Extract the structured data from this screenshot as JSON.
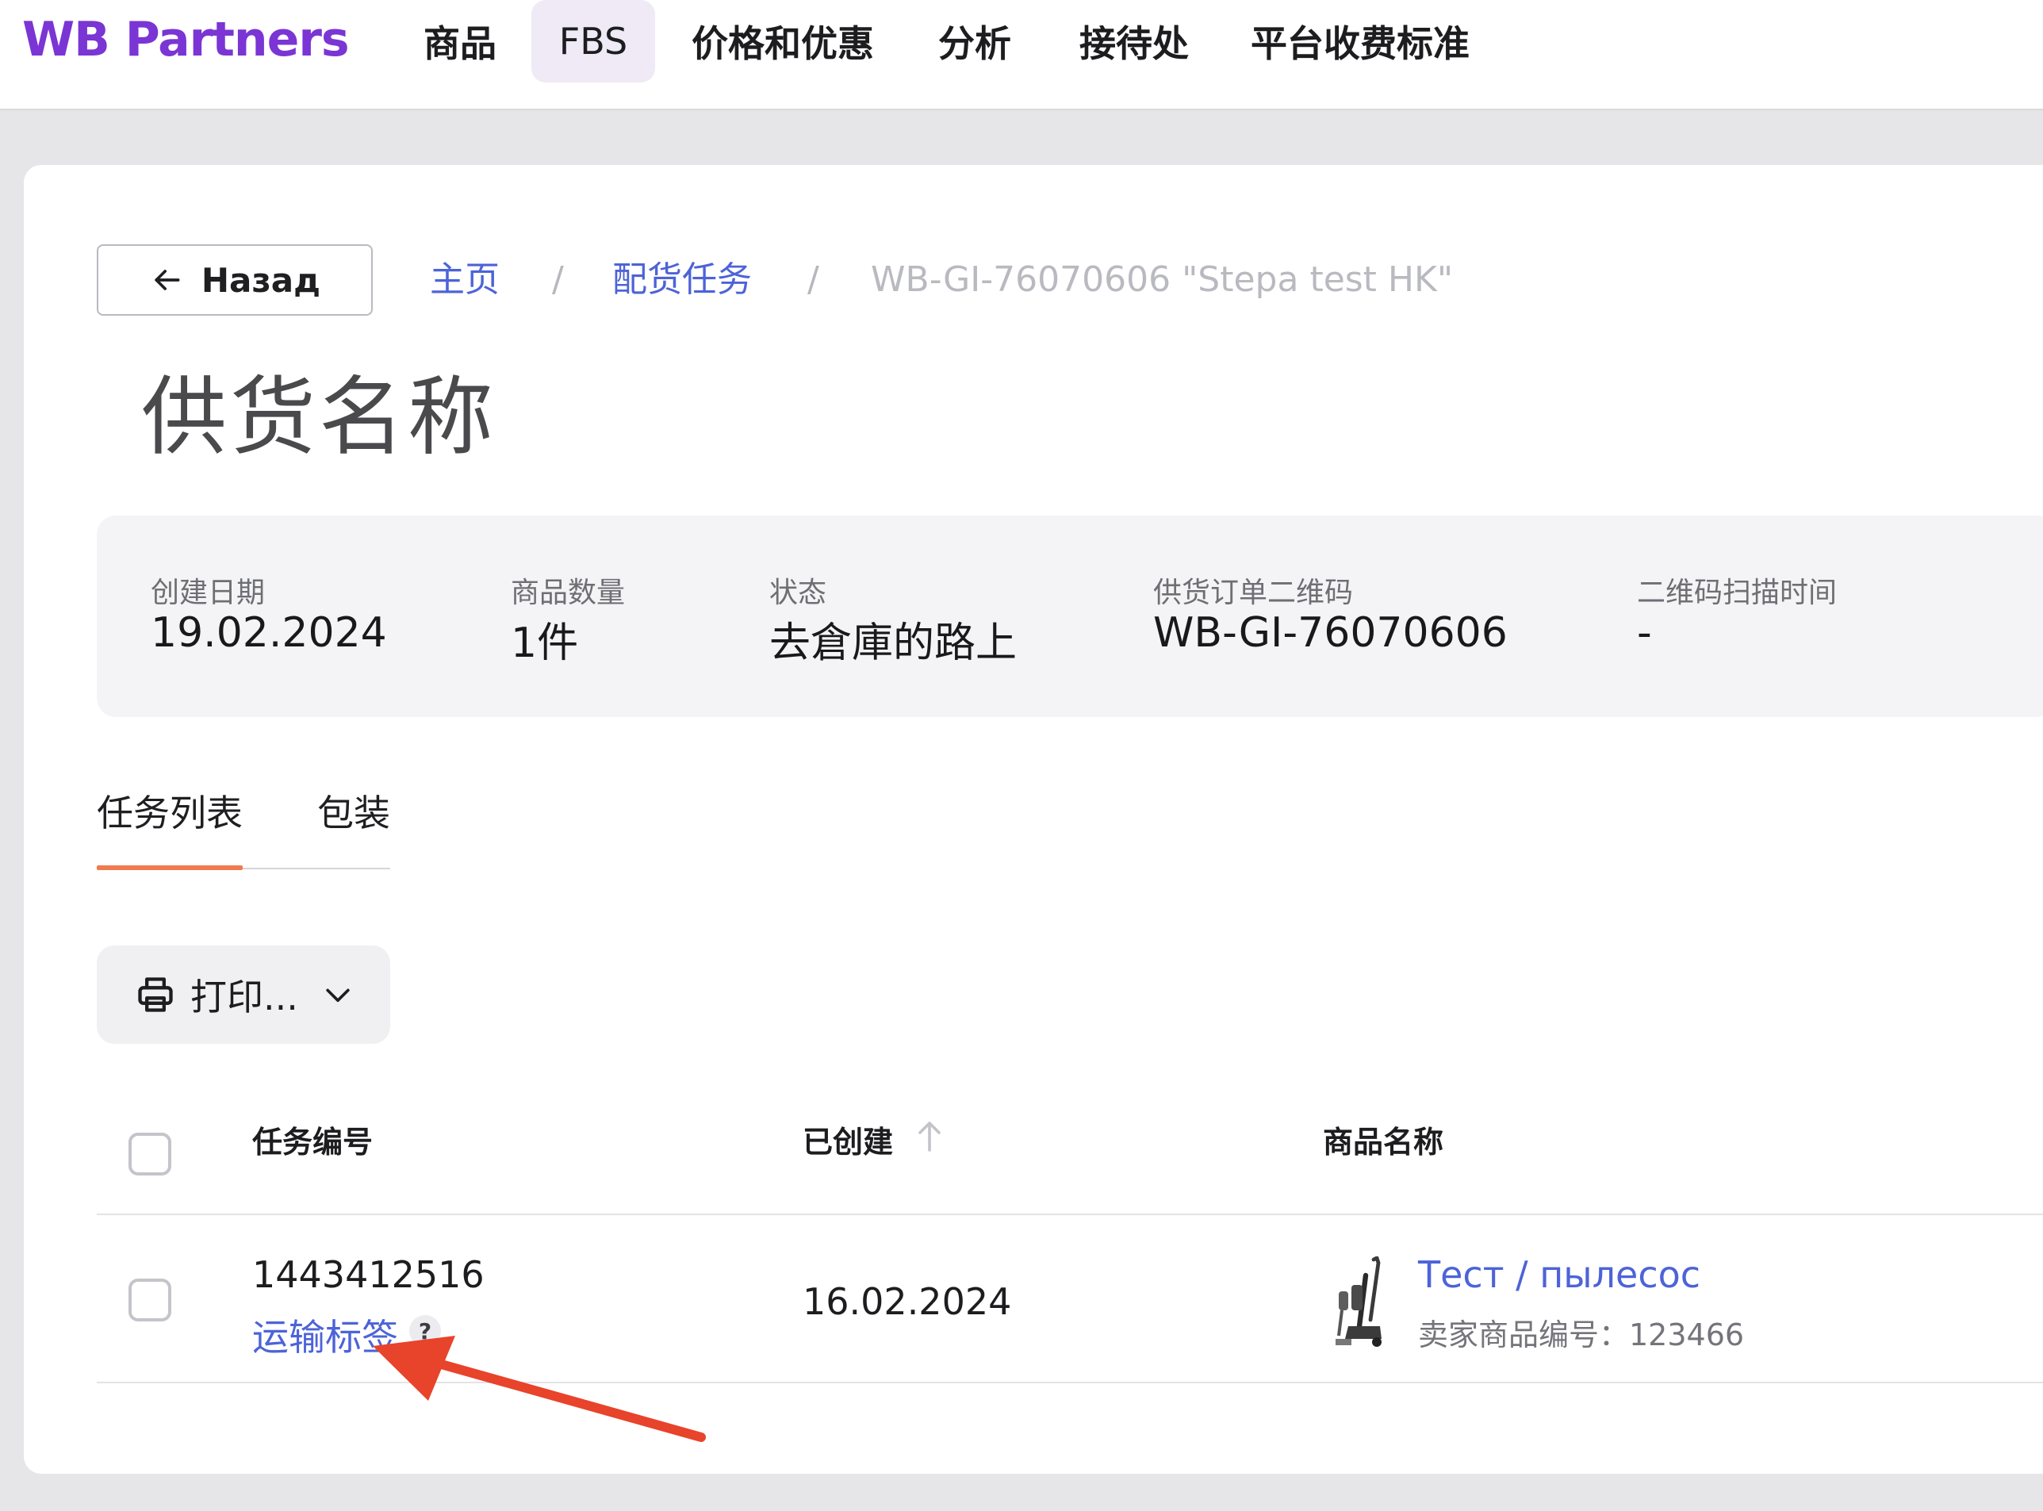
{
  "header": {
    "logo": "WB Partners",
    "nav": [
      "商品",
      "FBS",
      "价格和优惠",
      "分析",
      "接待处",
      "平台收费标准"
    ],
    "active_nav": "FBS"
  },
  "back_button": {
    "label": "Назад"
  },
  "breadcrumb": {
    "home": "主页",
    "section": "配货任务",
    "current": "WB-GI-76070606 \"Stepa test HK\"",
    "separator": "/"
  },
  "page_title": "供货名称",
  "info": {
    "created_date": {
      "label": "创建日期",
      "value": "19.02.2024"
    },
    "quantity": {
      "label": "商品数量",
      "value": "1件"
    },
    "status": {
      "label": "状态",
      "value": "去倉庫的路上"
    },
    "qr_code": {
      "label": "供货订单二维码",
      "value": "WB-GI-76070606"
    },
    "scan_time": {
      "label": "二维码扫描时间",
      "value": "-"
    }
  },
  "tabs": [
    {
      "label": "任务列表",
      "active": true
    },
    {
      "label": "包装",
      "active": false
    }
  ],
  "print_button": {
    "label": "打印..."
  },
  "table": {
    "columns": [
      "任务编号",
      "已创建",
      "商品名称"
    ],
    "rows": [
      {
        "task_number": "1443412516",
        "label_link": "运输标签",
        "help": "?",
        "created": "16.02.2024",
        "product_name": "Тест / пылесос",
        "seller_article": "卖家商品编号：123466"
      }
    ]
  },
  "colors": {
    "brand": "#7a35d4",
    "link": "#4d63d8",
    "tab_accent": "#f07b4f",
    "annotation_arrow": "#e8432b"
  },
  "icons": [
    "arrow-left-icon",
    "printer-icon",
    "chevron-down-icon",
    "sort-up-icon",
    "help-icon",
    "vacuum-product-image",
    "annotation-arrow"
  ]
}
